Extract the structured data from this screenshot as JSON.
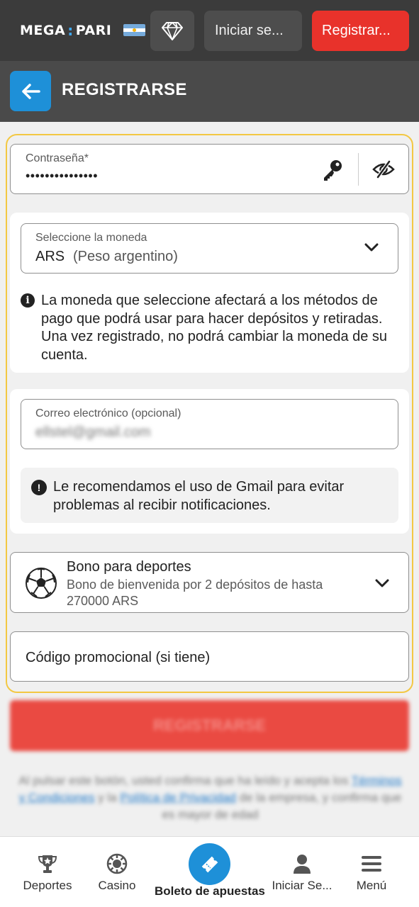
{
  "header": {
    "logo_left": "MEGA",
    "logo_colon": ":",
    "logo_right": "PARI",
    "login_label": "Iniciar se...",
    "register_label": "Registrar..."
  },
  "titlebar": {
    "title": "REGISTRARSE"
  },
  "form": {
    "password": {
      "label": "Contraseña*",
      "value": "•••••••••••••••"
    },
    "currency": {
      "label": "Seleccione la moneda",
      "code": "ARS",
      "name": "(Peso argentino)",
      "note": "La moneda que seleccione afectará a los métodos de pago que podrá usar para hacer depósitos y retiradas. Una vez registrado, no podrá cambiar la moneda de su cuenta."
    },
    "email": {
      "label": "Correo electrónico (opcional)",
      "value": "ellstel@gmail.com",
      "note": "Le recomendamos el uso de Gmail para evitar problemas al recibir notificaciones."
    },
    "bonus": {
      "title": "Bono para deportes",
      "description": "Bono de bienvenida por 2 depósitos de hasta 270000 ARS"
    },
    "promo": {
      "placeholder": "Código promocional (si tiene)"
    },
    "submit_label": "REGISTRARSE",
    "legal_text": "Al pulsar este botón, usted confirma que ha leído y acepta los",
    "legal_link1": "Términos y Condiciones",
    "legal_and": "y la",
    "legal_link2": "Política de Privacidad",
    "legal_rest": "de la empresa, y confirma que es mayor de edad"
  },
  "bottom_nav": {
    "items": [
      {
        "label": "Deportes"
      },
      {
        "label": "Casino"
      },
      {
        "label": "Boleto de apuestas"
      },
      {
        "label": "Iniciar Se..."
      },
      {
        "label": "Menú"
      }
    ]
  },
  "colors": {
    "brand_red": "#e8322b",
    "brand_blue": "#1e90d8",
    "highlight": "#f3c843"
  }
}
